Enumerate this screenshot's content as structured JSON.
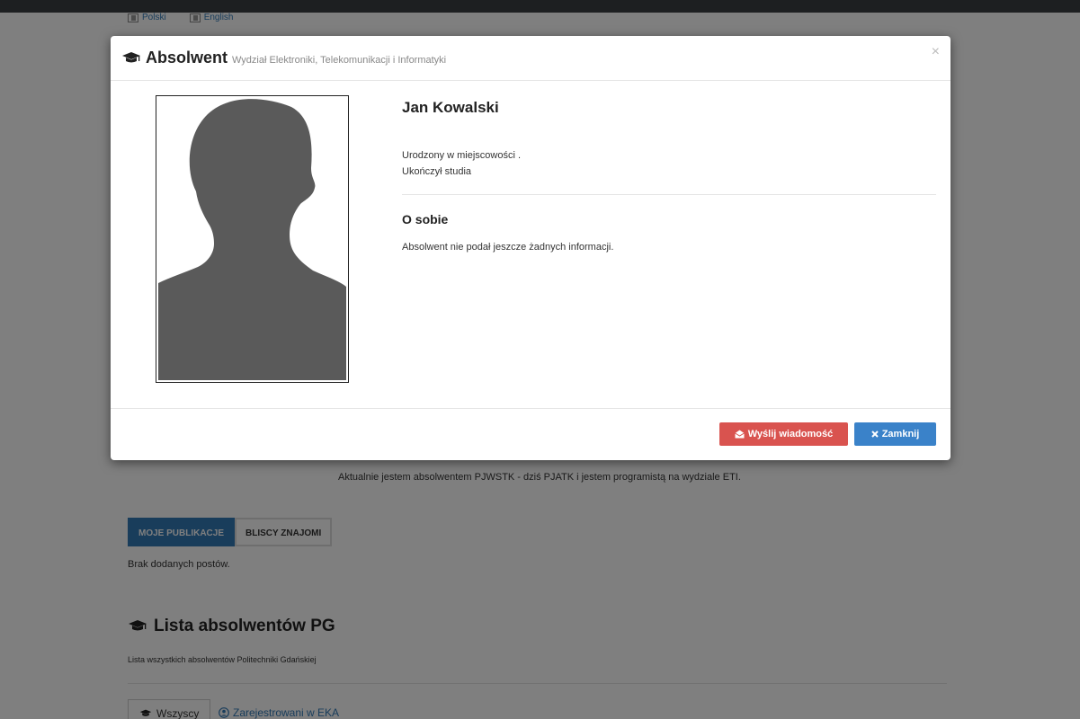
{
  "background": {
    "languages": [
      "Polski",
      "English"
    ],
    "about_text": "Aktualnie jestem absolwentem PJWSTK - dziś PJATK i jestem programistą na wydziale ETI.",
    "tabs": [
      "MOJE PUBLIKACJE",
      "BLISCY ZNAJOMI"
    ],
    "no_posts": "Brak dodanych postów.",
    "list_title": "Lista absolwentów PG",
    "list_subtitle": "Lista wszystkich absolwentów Politechniki Gdańskiej",
    "filters": [
      "Wszyscy",
      "Zarejestrowani w EKA"
    ]
  },
  "modal": {
    "title": "Absolwent",
    "subtitle": "Wydział Elektroniki, Telekomunikacji i Informatyki",
    "close_symbol": "×",
    "name": "Jan Kowalski",
    "born": "Urodzony w miejscowości .",
    "graduated": "Ukończył studia",
    "about_heading": "O sobie",
    "about_text": "Absolwent nie podał jeszcze żadnych informacji.",
    "send_button": "Wyślij wiadomość",
    "close_button": "Zamknij"
  },
  "colors": {
    "primary": "#337ab7",
    "danger": "#d9534f",
    "close_button": "#3a82c9",
    "silhouette": "#5a5a5a"
  },
  "icons": [
    "graduation-cap-icon",
    "envelope-icon",
    "times-icon",
    "flag-icon",
    "user-circle-icon"
  ]
}
